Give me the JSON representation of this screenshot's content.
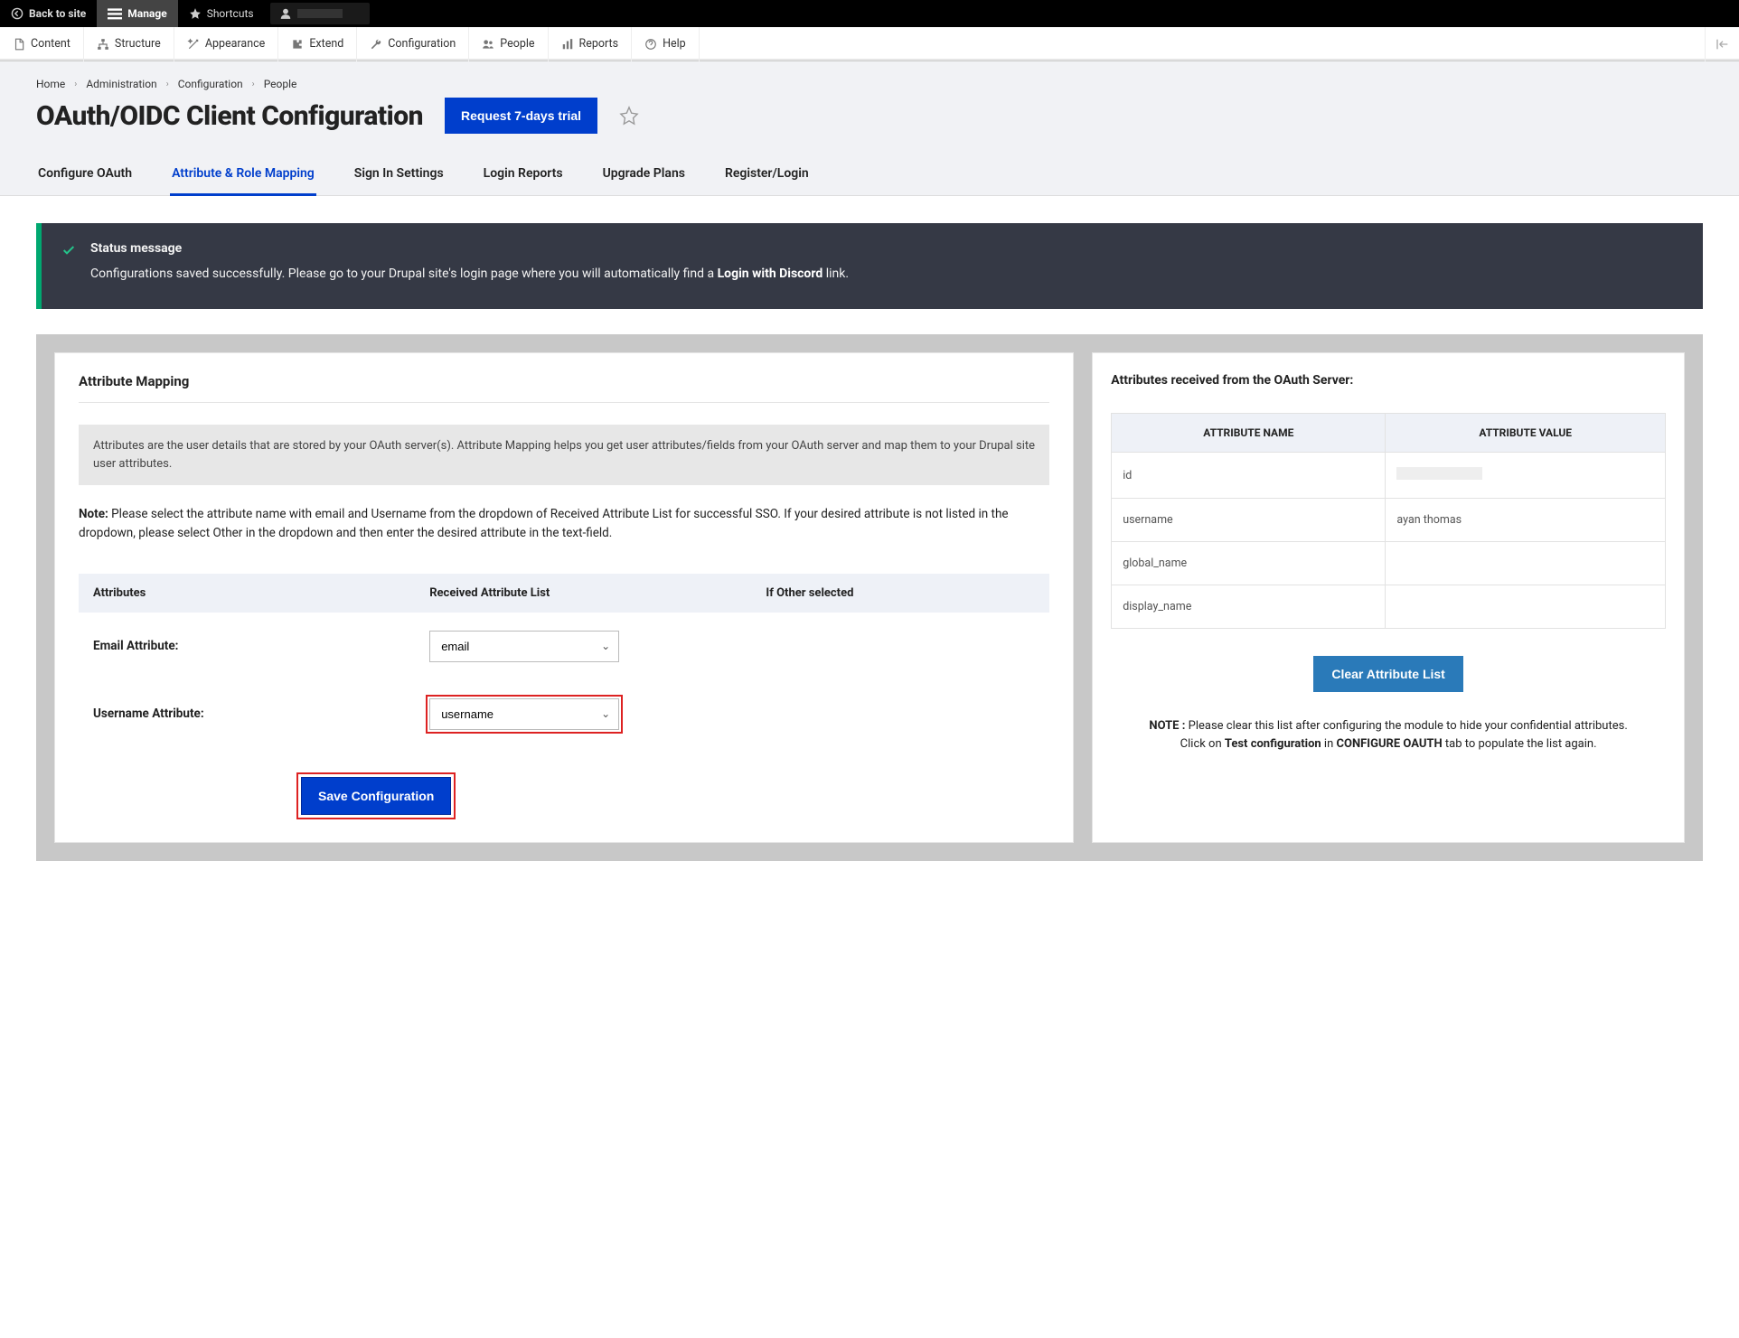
{
  "topbar": {
    "back_to_site": "Back to site",
    "manage": "Manage",
    "shortcuts": "Shortcuts"
  },
  "adminmenu": [
    {
      "icon": "file",
      "label": "Content"
    },
    {
      "icon": "tree",
      "label": "Structure"
    },
    {
      "icon": "wand",
      "label": "Appearance"
    },
    {
      "icon": "puzzle",
      "label": "Extend"
    },
    {
      "icon": "wrench",
      "label": "Configuration"
    },
    {
      "icon": "people",
      "label": "People"
    },
    {
      "icon": "bars",
      "label": "Reports"
    },
    {
      "icon": "help",
      "label": "Help"
    }
  ],
  "breadcrumb": [
    "Home",
    "Administration",
    "Configuration",
    "People"
  ],
  "page_title": "OAuth/OIDC Client Configuration",
  "trial_button": "Request 7-days trial",
  "tabs": [
    "Configure OAuth",
    "Attribute & Role Mapping",
    "Sign In Settings",
    "Login Reports",
    "Upgrade Plans",
    "Register/Login"
  ],
  "active_tab_index": 1,
  "status": {
    "title": "Status message",
    "text_pre": "Configurations saved successfully. Please go to your Drupal site's login page where you will automatically find a ",
    "text_bold": "Login with Discord",
    "text_post": " link."
  },
  "mapping": {
    "section_title": "Attribute Mapping",
    "info_text": "Attributes are the user details that are stored by your OAuth server(s). Attribute Mapping helps you get user attributes/fields from your OAuth server and map them to your Drupal site user attributes.",
    "note_label": "Note:",
    "note_text": " Please select the attribute name with email and Username from the dropdown of Received Attribute List for successful SSO. If your desired attribute is not listed in the dropdown, please select Other in the dropdown and then enter the desired attribute in the text-field.",
    "columns": {
      "c1": "Attributes",
      "c2": "Received Attribute List",
      "c3": "If Other selected"
    },
    "rows": [
      {
        "label": "Email Attribute:",
        "value": "email",
        "highlight": false
      },
      {
        "label": "Username Attribute:",
        "value": "username",
        "highlight": true
      }
    ],
    "save_label": "Save Configuration"
  },
  "received": {
    "title": "Attributes received from the OAuth Server:",
    "columns": {
      "name": "ATTRIBUTE NAME",
      "value": "ATTRIBUTE VALUE"
    },
    "rows": [
      {
        "name": "id",
        "value": "__redacted__"
      },
      {
        "name": "username",
        "value": "ayan thomas"
      },
      {
        "name": "global_name",
        "value": ""
      },
      {
        "name": "display_name",
        "value": ""
      }
    ],
    "clear_label": "Clear Attribute List",
    "note_label": "NOTE :",
    "note_text_1": " Please clear this list after configuring the module to hide your confidential attributes.",
    "note_text_2a": "Click on ",
    "note_text_2b": "Test configuration",
    "note_text_2c": " in ",
    "note_text_2d": "CONFIGURE OAUTH",
    "note_text_2e": " tab to populate the list again."
  }
}
